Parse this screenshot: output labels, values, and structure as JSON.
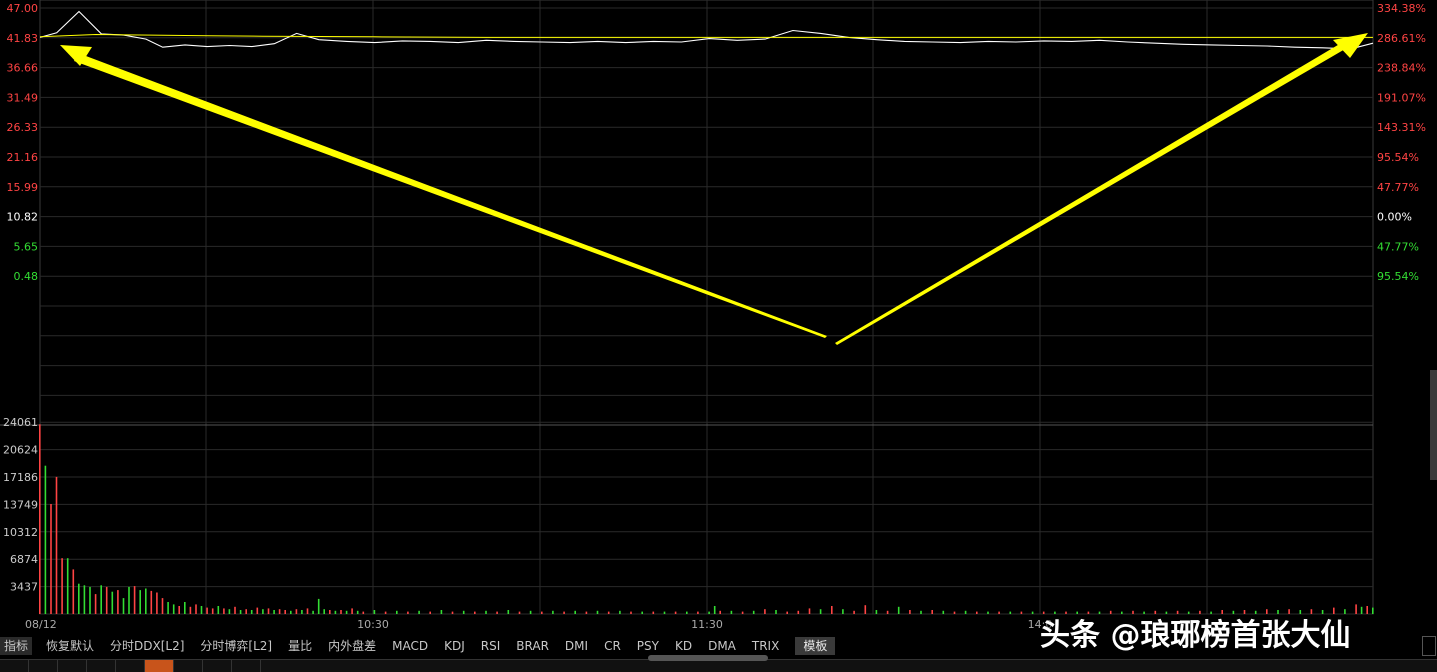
{
  "chart_data": [
    {
      "type": "line",
      "title": "",
      "x_ticks": [
        "10:30",
        "11:30",
        "14:0"
      ],
      "date_label": "08/12",
      "y_left_ticks": [
        "47.00",
        "41.83",
        "36.66",
        "31.49",
        "26.33",
        "21.16",
        "15.99",
        "10.82",
        "5.65",
        "0.48"
      ],
      "y_right_ticks": [
        "334.38%",
        "286.61%",
        "238.84%",
        "191.07%",
        "143.31%",
        "95.54%",
        "47.77%",
        "0.00%",
        "47.77%",
        "95.54%"
      ],
      "ylim": [
        -4.69,
        47.0
      ],
      "base_price": 10.82,
      "series": [
        {
          "color": "#ffffff",
          "x": [
            0,
            3,
            7,
            11,
            15,
            19,
            22,
            26,
            30,
            34,
            38,
            42,
            46,
            50,
            55,
            60,
            65,
            70,
            75,
            80,
            85,
            90,
            95,
            100,
            105,
            110,
            115,
            120,
            125,
            130,
            135,
            140,
            145,
            150,
            155,
            160,
            165,
            170,
            175,
            180,
            185,
            190,
            195,
            200,
            205,
            210,
            215,
            220,
            225,
            230,
            235,
            239
          ],
          "values": [
            41.9,
            42.7,
            46.4,
            42.5,
            42.3,
            41.6,
            40.2,
            40.6,
            40.3,
            40.5,
            40.3,
            40.8,
            42.6,
            41.5,
            41.2,
            41.0,
            41.3,
            41.2,
            41.0,
            41.4,
            41.2,
            41.1,
            41.0,
            41.2,
            41.0,
            41.2,
            41.1,
            41.7,
            41.4,
            41.6,
            43.1,
            42.6,
            41.9,
            41.5,
            41.2,
            41.1,
            41.0,
            41.2,
            41.1,
            41.3,
            41.2,
            41.4,
            41.1,
            40.9,
            40.7,
            40.6,
            40.5,
            40.4,
            40.2,
            40.1,
            39.9,
            40.9
          ]
        },
        {
          "color": "#ffff00",
          "x": [
            0,
            10,
            20,
            30,
            40,
            60,
            80,
            100,
            120,
            140,
            160,
            180,
            200,
            220,
            239
          ],
          "values": [
            42.0,
            42.4,
            42.3,
            42.2,
            42.1,
            42.0,
            41.9,
            41.9,
            41.9,
            41.9,
            41.9,
            41.9,
            41.9,
            41.9,
            41.9
          ]
        }
      ]
    },
    {
      "type": "bar",
      "title": "",
      "y_ticks": [
        "24061",
        "20624",
        "17186",
        "13749",
        "10312",
        "6874",
        "3437"
      ],
      "ylim": [
        0,
        24061
      ],
      "bars": [
        {
          "x": 0,
          "value": 23800,
          "dir": "up"
        },
        {
          "x": 1,
          "value": 18600,
          "dir": "down"
        },
        {
          "x": 2,
          "value": 13800,
          "dir": "up"
        },
        {
          "x": 3,
          "value": 17200,
          "dir": "up"
        },
        {
          "x": 4,
          "value": 7000,
          "dir": "up"
        },
        {
          "x": 5,
          "value": 7000,
          "dir": "down"
        },
        {
          "x": 6,
          "value": 5600,
          "dir": "up"
        },
        {
          "x": 7,
          "value": 3800,
          "dir": "down"
        },
        {
          "x": 8,
          "value": 3600,
          "dir": "down"
        },
        {
          "x": 9,
          "value": 3400,
          "dir": "down"
        },
        {
          "x": 10,
          "value": 2500,
          "dir": "up"
        },
        {
          "x": 11,
          "value": 3600,
          "dir": "down"
        },
        {
          "x": 12,
          "value": 3400,
          "dir": "up"
        },
        {
          "x": 13,
          "value": 2800,
          "dir": "down"
        },
        {
          "x": 14,
          "value": 3000,
          "dir": "up"
        },
        {
          "x": 15,
          "value": 2000,
          "dir": "down"
        },
        {
          "x": 16,
          "value": 3400,
          "dir": "down"
        },
        {
          "x": 17,
          "value": 3500,
          "dir": "up"
        },
        {
          "x": 18,
          "value": 3000,
          "dir": "down"
        },
        {
          "x": 19,
          "value": 3200,
          "dir": "down"
        },
        {
          "x": 20,
          "value": 2900,
          "dir": "up"
        },
        {
          "x": 21,
          "value": 2700,
          "dir": "up"
        },
        {
          "x": 22,
          "value": 2000,
          "dir": "up"
        },
        {
          "x": 23,
          "value": 1500,
          "dir": "down"
        },
        {
          "x": 24,
          "value": 1200,
          "dir": "down"
        },
        {
          "x": 25,
          "value": 1000,
          "dir": "up"
        },
        {
          "x": 26,
          "value": 1500,
          "dir": "down"
        },
        {
          "x": 27,
          "value": 900,
          "dir": "up"
        },
        {
          "x": 28,
          "value": 1200,
          "dir": "up"
        },
        {
          "x": 29,
          "value": 1000,
          "dir": "down"
        },
        {
          "x": 30,
          "value": 800,
          "dir": "up"
        },
        {
          "x": 31,
          "value": 700,
          "dir": "up"
        },
        {
          "x": 32,
          "value": 1000,
          "dir": "down"
        },
        {
          "x": 33,
          "value": 700,
          "dir": "up"
        },
        {
          "x": 34,
          "value": 600,
          "dir": "down"
        },
        {
          "x": 35,
          "value": 900,
          "dir": "up"
        },
        {
          "x": 36,
          "value": 500,
          "dir": "down"
        },
        {
          "x": 37,
          "value": 600,
          "dir": "up"
        },
        {
          "x": 38,
          "value": 500,
          "dir": "down"
        },
        {
          "x": 39,
          "value": 800,
          "dir": "up"
        },
        {
          "x": 40,
          "value": 600,
          "dir": "down"
        },
        {
          "x": 41,
          "value": 700,
          "dir": "up"
        },
        {
          "x": 42,
          "value": 500,
          "dir": "down"
        },
        {
          "x": 43,
          "value": 600,
          "dir": "up"
        },
        {
          "x": 44,
          "value": 500,
          "dir": "up"
        },
        {
          "x": 45,
          "value": 400,
          "dir": "down"
        },
        {
          "x": 46,
          "value": 600,
          "dir": "up"
        },
        {
          "x": 47,
          "value": 500,
          "dir": "down"
        },
        {
          "x": 48,
          "value": 700,
          "dir": "up"
        },
        {
          "x": 49,
          "value": 400,
          "dir": "down"
        },
        {
          "x": 50,
          "value": 1900,
          "dir": "down"
        },
        {
          "x": 51,
          "value": 600,
          "dir": "down"
        },
        {
          "x": 52,
          "value": 500,
          "dir": "up"
        },
        {
          "x": 53,
          "value": 400,
          "dir": "down"
        },
        {
          "x": 54,
          "value": 500,
          "dir": "up"
        },
        {
          "x": 55,
          "value": 400,
          "dir": "down"
        },
        {
          "x": 56,
          "value": 700,
          "dir": "up"
        },
        {
          "x": 57,
          "value": 400,
          "dir": "down"
        },
        {
          "x": 58,
          "value": 300,
          "dir": "up"
        },
        {
          "x": 60,
          "value": 500,
          "dir": "down"
        },
        {
          "x": 62,
          "value": 300,
          "dir": "up"
        },
        {
          "x": 64,
          "value": 400,
          "dir": "down"
        },
        {
          "x": 66,
          "value": 300,
          "dir": "up"
        },
        {
          "x": 68,
          "value": 400,
          "dir": "down"
        },
        {
          "x": 70,
          "value": 300,
          "dir": "up"
        },
        {
          "x": 72,
          "value": 500,
          "dir": "down"
        },
        {
          "x": 74,
          "value": 300,
          "dir": "up"
        },
        {
          "x": 76,
          "value": 400,
          "dir": "down"
        },
        {
          "x": 78,
          "value": 300,
          "dir": "up"
        },
        {
          "x": 80,
          "value": 400,
          "dir": "down"
        },
        {
          "x": 82,
          "value": 300,
          "dir": "up"
        },
        {
          "x": 84,
          "value": 500,
          "dir": "down"
        },
        {
          "x": 86,
          "value": 300,
          "dir": "up"
        },
        {
          "x": 88,
          "value": 400,
          "dir": "down"
        },
        {
          "x": 90,
          "value": 300,
          "dir": "up"
        },
        {
          "x": 92,
          "value": 400,
          "dir": "down"
        },
        {
          "x": 94,
          "value": 300,
          "dir": "up"
        },
        {
          "x": 96,
          "value": 400,
          "dir": "down"
        },
        {
          "x": 98,
          "value": 300,
          "dir": "up"
        },
        {
          "x": 100,
          "value": 400,
          "dir": "down"
        },
        {
          "x": 102,
          "value": 300,
          "dir": "up"
        },
        {
          "x": 104,
          "value": 400,
          "dir": "down"
        },
        {
          "x": 106,
          "value": 300,
          "dir": "up"
        },
        {
          "x": 108,
          "value": 300,
          "dir": "down"
        },
        {
          "x": 110,
          "value": 300,
          "dir": "up"
        },
        {
          "x": 112,
          "value": 300,
          "dir": "down"
        },
        {
          "x": 114,
          "value": 300,
          "dir": "up"
        },
        {
          "x": 116,
          "value": 300,
          "dir": "down"
        },
        {
          "x": 118,
          "value": 300,
          "dir": "up"
        },
        {
          "x": 120,
          "value": 300,
          "dir": "down"
        },
        {
          "x": 121,
          "value": 1000,
          "dir": "down"
        },
        {
          "x": 122,
          "value": 400,
          "dir": "up"
        },
        {
          "x": 124,
          "value": 400,
          "dir": "down"
        },
        {
          "x": 126,
          "value": 300,
          "dir": "up"
        },
        {
          "x": 128,
          "value": 400,
          "dir": "down"
        },
        {
          "x": 130,
          "value": 600,
          "dir": "up"
        },
        {
          "x": 132,
          "value": 500,
          "dir": "down"
        },
        {
          "x": 134,
          "value": 300,
          "dir": "up"
        },
        {
          "x": 136,
          "value": 400,
          "dir": "up"
        },
        {
          "x": 138,
          "value": 700,
          "dir": "up"
        },
        {
          "x": 140,
          "value": 600,
          "dir": "down"
        },
        {
          "x": 142,
          "value": 1000,
          "dir": "up"
        },
        {
          "x": 144,
          "value": 600,
          "dir": "down"
        },
        {
          "x": 146,
          "value": 400,
          "dir": "up"
        },
        {
          "x": 148,
          "value": 1100,
          "dir": "up"
        },
        {
          "x": 150,
          "value": 500,
          "dir": "down"
        },
        {
          "x": 152,
          "value": 400,
          "dir": "up"
        },
        {
          "x": 154,
          "value": 900,
          "dir": "down"
        },
        {
          "x": 156,
          "value": 500,
          "dir": "up"
        },
        {
          "x": 158,
          "value": 400,
          "dir": "down"
        },
        {
          "x": 160,
          "value": 500,
          "dir": "up"
        },
        {
          "x": 162,
          "value": 400,
          "dir": "down"
        },
        {
          "x": 164,
          "value": 300,
          "dir": "up"
        },
        {
          "x": 166,
          "value": 400,
          "dir": "down"
        },
        {
          "x": 168,
          "value": 300,
          "dir": "up"
        },
        {
          "x": 170,
          "value": 300,
          "dir": "down"
        },
        {
          "x": 172,
          "value": 300,
          "dir": "up"
        },
        {
          "x": 174,
          "value": 300,
          "dir": "down"
        },
        {
          "x": 176,
          "value": 300,
          "dir": "up"
        },
        {
          "x": 178,
          "value": 300,
          "dir": "down"
        },
        {
          "x": 180,
          "value": 300,
          "dir": "up"
        },
        {
          "x": 182,
          "value": 300,
          "dir": "down"
        },
        {
          "x": 184,
          "value": 300,
          "dir": "up"
        },
        {
          "x": 186,
          "value": 300,
          "dir": "down"
        },
        {
          "x": 188,
          "value": 300,
          "dir": "up"
        },
        {
          "x": 190,
          "value": 300,
          "dir": "down"
        },
        {
          "x": 192,
          "value": 400,
          "dir": "up"
        },
        {
          "x": 194,
          "value": 300,
          "dir": "down"
        },
        {
          "x": 196,
          "value": 400,
          "dir": "up"
        },
        {
          "x": 198,
          "value": 300,
          "dir": "down"
        },
        {
          "x": 200,
          "value": 400,
          "dir": "up"
        },
        {
          "x": 202,
          "value": 300,
          "dir": "down"
        },
        {
          "x": 204,
          "value": 400,
          "dir": "up"
        },
        {
          "x": 206,
          "value": 300,
          "dir": "down"
        },
        {
          "x": 208,
          "value": 400,
          "dir": "up"
        },
        {
          "x": 210,
          "value": 300,
          "dir": "down"
        },
        {
          "x": 212,
          "value": 500,
          "dir": "up"
        },
        {
          "x": 214,
          "value": 400,
          "dir": "down"
        },
        {
          "x": 216,
          "value": 500,
          "dir": "up"
        },
        {
          "x": 218,
          "value": 400,
          "dir": "down"
        },
        {
          "x": 220,
          "value": 600,
          "dir": "up"
        },
        {
          "x": 222,
          "value": 500,
          "dir": "down"
        },
        {
          "x": 224,
          "value": 600,
          "dir": "up"
        },
        {
          "x": 226,
          "value": 500,
          "dir": "down"
        },
        {
          "x": 228,
          "value": 600,
          "dir": "up"
        },
        {
          "x": 230,
          "value": 500,
          "dir": "down"
        },
        {
          "x": 232,
          "value": 800,
          "dir": "up"
        },
        {
          "x": 234,
          "value": 600,
          "dir": "down"
        },
        {
          "x": 236,
          "value": 1200,
          "dir": "up"
        },
        {
          "x": 237,
          "value": 900,
          "dir": "down"
        },
        {
          "x": 238,
          "value": 1000,
          "dir": "up"
        },
        {
          "x": 239,
          "value": 800,
          "dir": "down"
        }
      ]
    }
  ],
  "colors": {
    "up": "#ff4444",
    "down": "#33dd33",
    "neutral": "#ffffff",
    "price_line": "#ffffff",
    "avg_line": "#ffff00",
    "annotation_arrow": "#ffff00",
    "grid": "#2a2a2a",
    "active_bottom_tab": "#c8541b"
  },
  "indicator_tabs": [
    "指标",
    "恢复默认",
    "分时DDX[L2]",
    "分时博弈[L2]",
    "量比",
    "内外盘差",
    "MACD",
    "KDJ",
    "RSI",
    "BRAR",
    "DMI",
    "CR",
    "PSY",
    "KD",
    "DMA",
    "TRIX",
    "模板"
  ],
  "watermark": "头条 @琅琊榜首张大仙",
  "icons": [
    "arrow-annotation-icon",
    "scroll-arrow-icon",
    "corner-icon"
  ]
}
